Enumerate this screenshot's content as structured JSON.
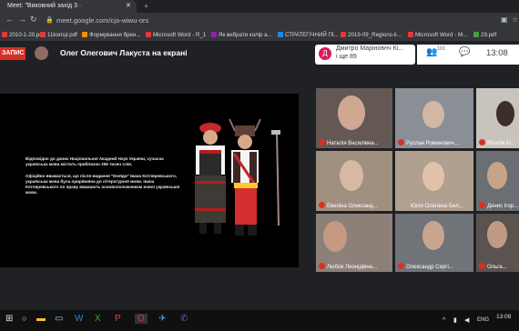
{
  "browser": {
    "tab_title": "Meet: \"Виковний захід 3 ·",
    "tab_close": "✕",
    "new_tab": "+",
    "url": "meet.google.com/cja-wiwu-ors",
    "bookmarks": [
      {
        "label": "2010-1-20.pdf",
        "color": "#e53935"
      },
      {
        "label": "11konsjr.pdf",
        "color": "#e53935"
      },
      {
        "label": "Формування брен...",
        "color": "#fb8c00"
      },
      {
        "label": "Microsoft Word - R_1",
        "color": "#e53935"
      },
      {
        "label": "Як вибрати колір а...",
        "color": "#8e24aa"
      },
      {
        "label": "СТРАТЕГІЧНИЙ ПІ...",
        "color": "#1e88e5"
      },
      {
        "label": "2019-09_Regions-li...",
        "color": "#e53935"
      },
      {
        "label": "Microsoft Word - M...",
        "color": "#e53935"
      },
      {
        "label": "29.pdf",
        "color": "#43a047"
      }
    ]
  },
  "meet": {
    "record_badge": "ЗАПИС",
    "presenter_text": "Олег Олегович Лакуста на екрані",
    "participant_chip": {
      "avatar_letter": "Д",
      "name": "Дмитро Маріновнч Кі...",
      "more": "і ще 89"
    },
    "people_count": "101",
    "time": "13:08"
  },
  "slide": {
    "paragraphs": [
      "Відповідно до даних Національної Академії Наук України, сучасна українська мова містить приблизно 256 тисяч слів.",
      "Офіційно вважається, що після видання \"Енеїди\" Івана Котляревського, українська мова була прирівняна до літературної мови. Івана Котляревського по праву вважають основоположником нової української мови."
    ]
  },
  "participants": [
    {
      "name": "Наталія Василівна...",
      "muted": true,
      "bg": "#b08878"
    },
    {
      "name": "Руслан Романович...",
      "muted": true,
      "bg": "#8a8f96"
    },
    {
      "name": "Віталія Кі...",
      "muted": true,
      "bg": "#c9c3bd"
    },
    {
      "name": "Евеліна Олександ...",
      "muted": true,
      "bg": "#a09080"
    },
    {
      "name": "Юлія Олегівна Бел...",
      "muted": false,
      "bg": "#b0a090"
    },
    {
      "name": "Денис Ігор...",
      "muted": true,
      "bg": "#6b6e72"
    },
    {
      "name": "Любов Леонідівна...",
      "muted": true,
      "bg": "#8c8079"
    },
    {
      "name": "Олександр Сергі...",
      "muted": true,
      "bg": "#707478"
    },
    {
      "name": "Ольга...",
      "muted": true,
      "bg": "#5a5350"
    }
  ],
  "taskbar": {
    "lang": "ENG",
    "time": "13:08"
  }
}
